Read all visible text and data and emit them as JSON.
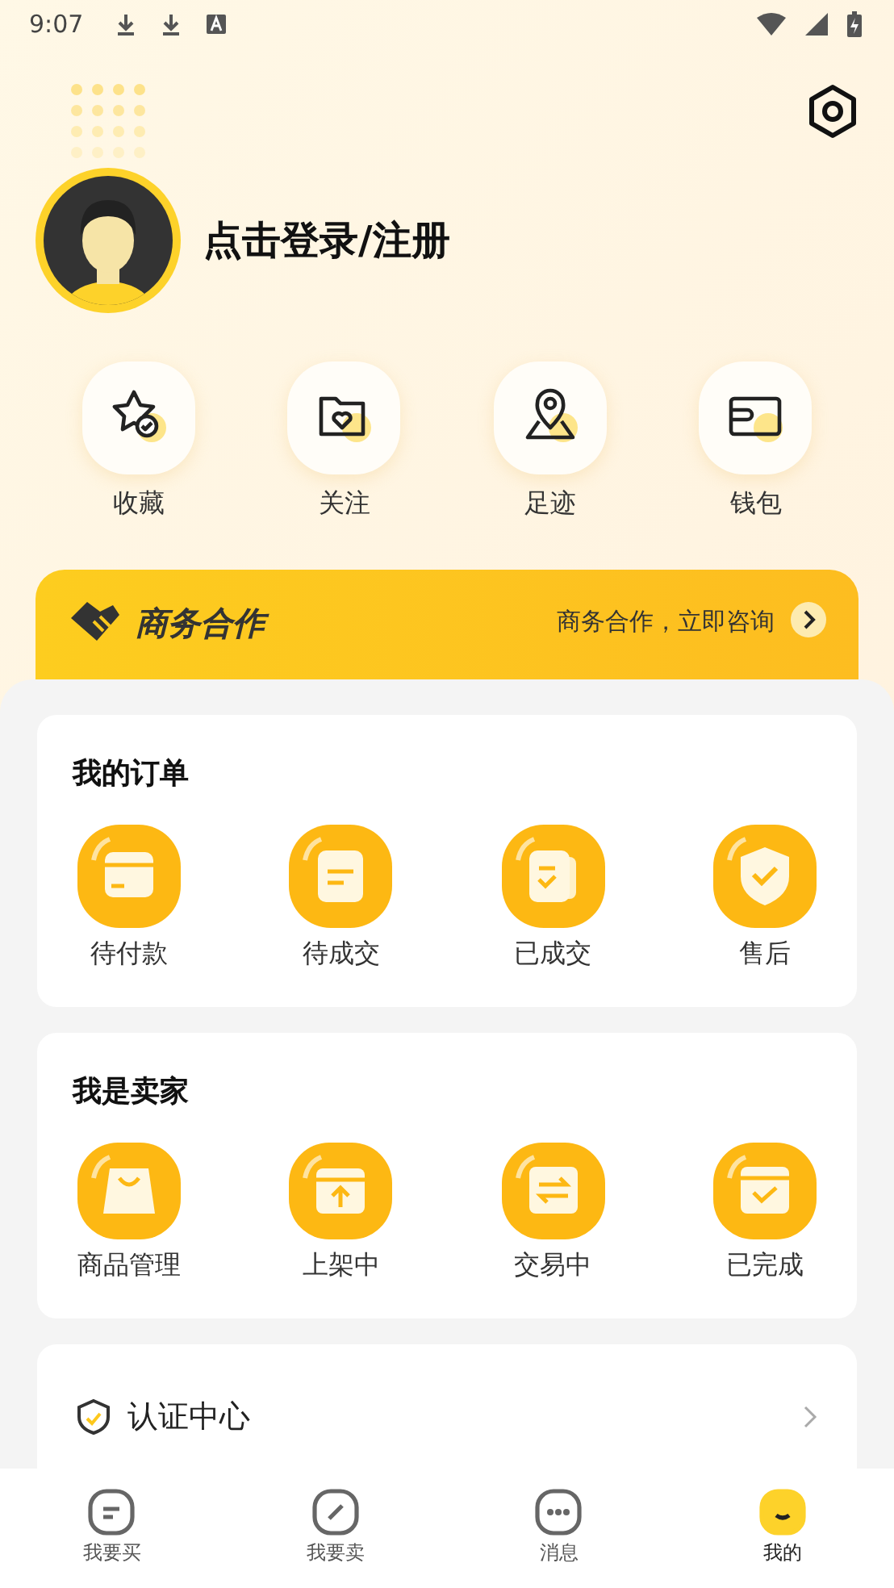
{
  "status_bar": {
    "time": "9:07"
  },
  "profile": {
    "login_prompt": "点击登录/注册"
  },
  "shortcuts": [
    {
      "label": "收藏"
    },
    {
      "label": "关注"
    },
    {
      "label": "足迹"
    },
    {
      "label": "钱包"
    }
  ],
  "banner": {
    "title": "商务合作",
    "link": "商务合作，立即咨询"
  },
  "orders": {
    "title": "我的订单",
    "items": [
      {
        "label": "待付款"
      },
      {
        "label": "待成交"
      },
      {
        "label": "已成交"
      },
      {
        "label": "售后"
      }
    ]
  },
  "seller": {
    "title": "我是卖家",
    "items": [
      {
        "label": "商品管理"
      },
      {
        "label": "上架中"
      },
      {
        "label": "交易中"
      },
      {
        "label": "已完成"
      }
    ]
  },
  "certification": {
    "label": "认证中心"
  },
  "tab_bar": [
    {
      "label": "我要买",
      "selected": false
    },
    {
      "label": "我要卖",
      "selected": false
    },
    {
      "label": "消息",
      "selected": false
    },
    {
      "label": "我的",
      "selected": true
    }
  ]
}
